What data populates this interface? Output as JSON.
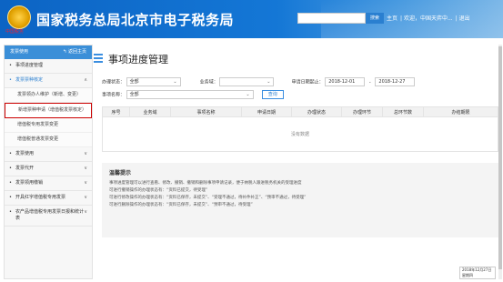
{
  "header": {
    "title": "国家税务总局北京市电子税务局",
    "emblem_caption": "中国税务",
    "search_button": "搜索",
    "links": [
      "主页",
      "欢迎，中国天弈中...",
      "退出"
    ]
  },
  "sidebar": {
    "top_label": "发票使用",
    "back_label": "返回主页",
    "items": [
      {
        "label": "事项进度管理",
        "chevron": ""
      },
      {
        "label": "发票票种核定",
        "chevron": "∧"
      },
      {
        "label": "发票使用",
        "chevron": "∨"
      },
      {
        "label": "发票代开",
        "chevron": "∨"
      },
      {
        "label": "发票领用缴销",
        "chevron": "∨"
      },
      {
        "label": "开具红字增值税专用发票",
        "chevron": "∨"
      },
      {
        "label": "农产品增值税专用发票日报和统计表",
        "chevron": "∨"
      }
    ],
    "sub_items": [
      "发票领办人维护（新增、变更）",
      "新增票种申请（增值税发票核定）",
      "增值税专用发票变更",
      "增值税普通发票变更"
    ]
  },
  "main": {
    "title": "事项进度管理",
    "filters": {
      "status_label": "办理状态：",
      "status_value": "全部",
      "business_label": "业务域：",
      "business_value": "",
      "date_label": "申请日期起止：",
      "date_from": "2018-12-01",
      "date_sep": "-",
      "date_to": "2018-12-27",
      "item_label": "事项名称：",
      "item_value": "全部",
      "query_button": "查询"
    },
    "table": {
      "headers": [
        "序号",
        "业务域",
        "事项名称",
        "申请日期",
        "办理状态",
        "办理环节",
        "总环节数",
        "办结期限"
      ],
      "empty_text": "没有数据"
    },
    "tips": {
      "title": "温馨提示",
      "lines": [
        "事项进度管理可以进行查看、修改、撤销、撤销和删除事项申请记录，便于纳税人跟进税务机关的受理进度",
        "可进行撤销操作的办理状态有：“资料已提交，待受理”",
        "可进行修改操作的办理状态有：“资料已保存，未提交”、“受理不通过，待补件补正”、“预审不通过，待受理”",
        "可进行删除操作的办理状态有：“资料已保存，未提交”、“预审不通过，待受理”"
      ]
    }
  },
  "tray": {
    "date": "2018年12月27日",
    "day": "星期四"
  }
}
